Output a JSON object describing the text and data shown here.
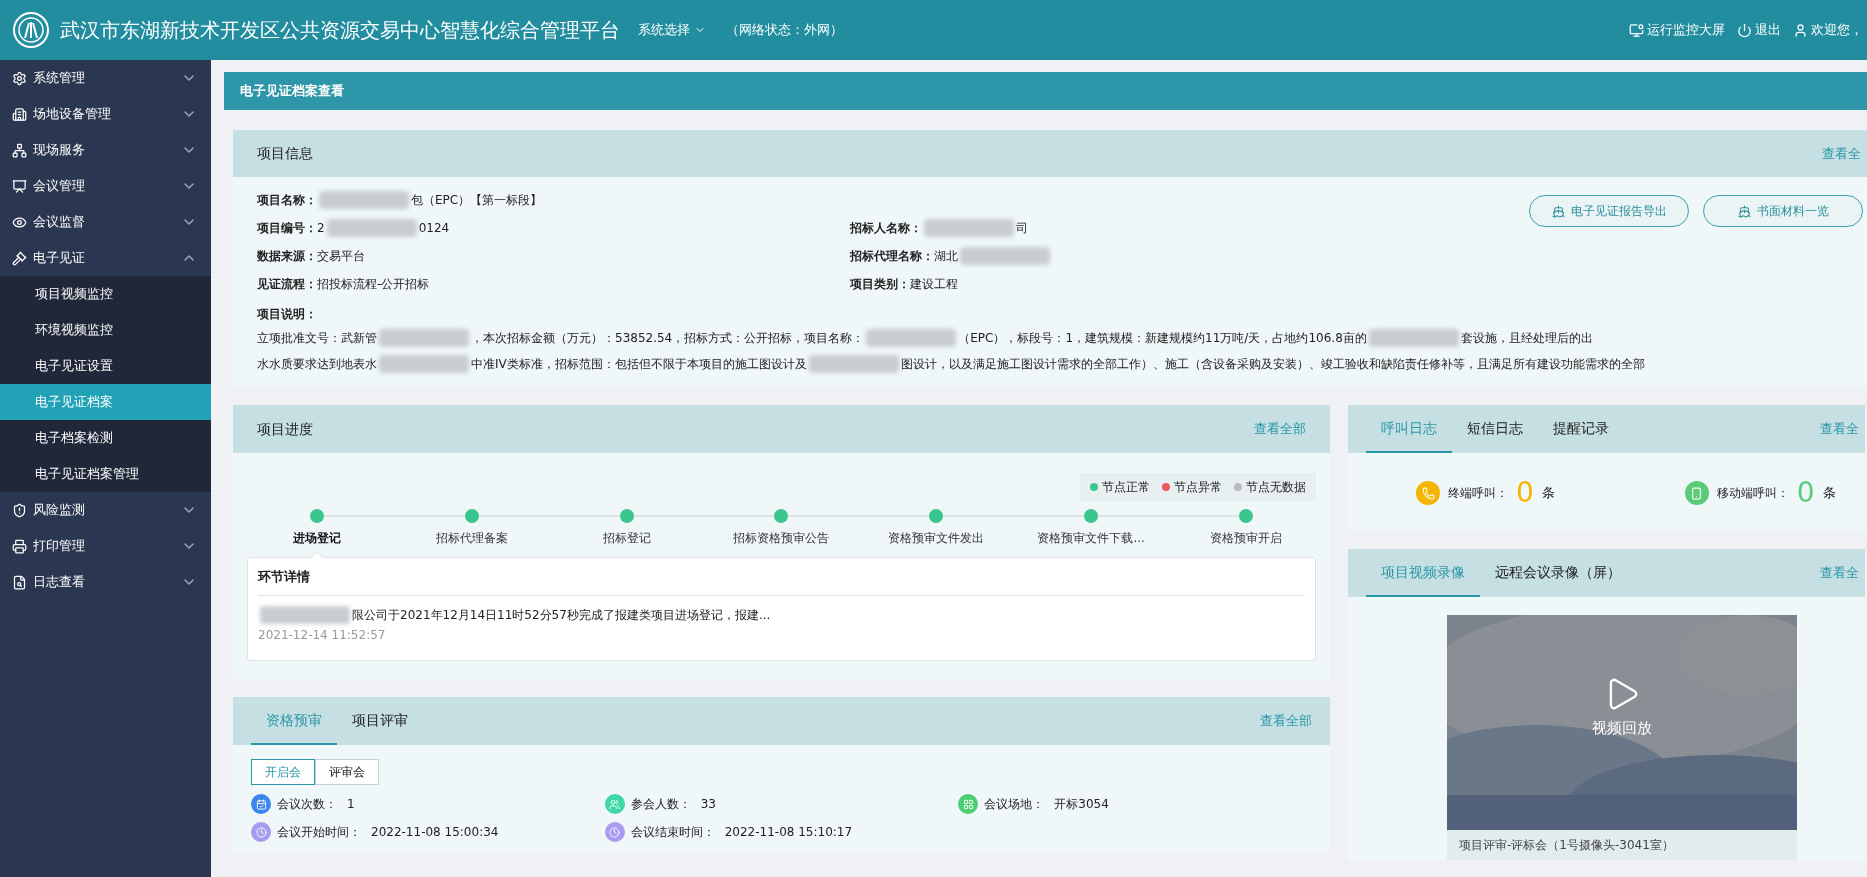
{
  "header": {
    "title": "武汉市东湖新技术开发区公共资源交易中心智慧化综合管理平台",
    "system_select": "系统选择",
    "network": "（网络状态：外网）",
    "actions": [
      {
        "kind": "monitor",
        "label": "运行监控大屏"
      },
      {
        "kind": "power",
        "label": "退出"
      },
      {
        "kind": "user",
        "label": "欢迎您，"
      }
    ]
  },
  "sidebar": {
    "items": [
      {
        "kind": "gear",
        "label": "系统管理",
        "expanded": false
      },
      {
        "kind": "equipment",
        "label": "场地设备管理",
        "expanded": false
      },
      {
        "kind": "service",
        "label": "现场服务",
        "expanded": false
      },
      {
        "kind": "meeting",
        "label": "会议管理",
        "expanded": false
      },
      {
        "kind": "supervise",
        "label": "会议监督",
        "expanded": false
      },
      {
        "kind": "evidence",
        "label": "电子见证",
        "expanded": true,
        "children": [
          {
            "label": "项目视频监控",
            "selected": false
          },
          {
            "label": "环境视频监控",
            "selected": false
          },
          {
            "label": "电子见证设置",
            "selected": false
          },
          {
            "label": "电子见证档案",
            "selected": true
          },
          {
            "label": "电子档案检测",
            "selected": false
          },
          {
            "label": "电子见证档案管理",
            "selected": false
          }
        ]
      },
      {
        "kind": "risk",
        "label": "风险监测",
        "expanded": false
      },
      {
        "kind": "print",
        "label": "打印管理",
        "expanded": false
      },
      {
        "kind": "log",
        "label": "日志查看",
        "expanded": false
      }
    ]
  },
  "breadcrumb": "电子见证档案查看",
  "project_info": {
    "title": "项目信息",
    "view_all": "查看全",
    "left_fields": [
      {
        "label": "项目名称：",
        "parts": [
          {
            "kind": "redacted"
          },
          {
            "kind": "text",
            "text": "包（EPC）【第一标段】"
          }
        ]
      },
      {
        "label": "项目编号：",
        "parts": [
          {
            "kind": "text",
            "text": "2"
          },
          {
            "kind": "redacted"
          },
          {
            "kind": "text",
            "text": "0124"
          }
        ]
      },
      {
        "label": "数据来源：",
        "parts": [
          {
            "kind": "text",
            "text": "交易平台"
          }
        ]
      },
      {
        "label": "见证流程：",
        "parts": [
          {
            "kind": "text",
            "text": "招投标流程-公开招标"
          }
        ]
      }
    ],
    "right_fields": [
      {
        "label": "招标人名称：",
        "parts": [
          {
            "kind": "redacted"
          },
          {
            "kind": "text",
            "text": "司"
          }
        ]
      },
      {
        "label": "招标代理名称：",
        "parts": [
          {
            "kind": "text",
            "text": "湖北"
          },
          {
            "kind": "redacted"
          }
        ]
      },
      {
        "label": "项目类别：",
        "parts": [
          {
            "kind": "text",
            "text": "建设工程"
          }
        ]
      }
    ],
    "buttons": [
      "电子见证报告导出",
      "书面材料一览"
    ],
    "description_label": "项目说明：",
    "description_lines": [
      [
        {
          "kind": "text",
          "text": "立项批准文号：武新管"
        },
        {
          "kind": "redacted"
        },
        {
          "kind": "text",
          "text": "，本次招标金额（万元）：53852.54，招标方式：公开招标，项目名称："
        },
        {
          "kind": "redacted"
        },
        {
          "kind": "text",
          "text": "（EPC），标段号：1，建筑规模：新建规模约11万吨/天，占地约106.8亩的"
        },
        {
          "kind": "redacted"
        },
        {
          "kind": "text",
          "text": "套设施，且经处理后的出"
        }
      ],
      [
        {
          "kind": "text",
          "text": "水水质要求达到地表水"
        },
        {
          "kind": "redacted"
        },
        {
          "kind": "text",
          "text": "中准IV类标准，招标范围：包括但不限于本项目的施工图设计及"
        },
        {
          "kind": "redacted"
        },
        {
          "kind": "text",
          "text": "图设计，以及满足施工图设计需求的全部工作）、施工（含设备采购及安装）、竣工验收和缺陷责任修补等，且满足所有建设功能需求的全部"
        }
      ]
    ]
  },
  "progress": {
    "title": "项目进度",
    "view_all": "查看全部",
    "legend": [
      {
        "label": "节点正常",
        "color": "#3cc68f"
      },
      {
        "label": "节点异常",
        "color": "#ee5a5a"
      },
      {
        "label": "节点无数据",
        "color": "#bbbbbb"
      }
    ],
    "steps": [
      {
        "label": "进场登记",
        "color": "#3cc68f",
        "selected": true
      },
      {
        "label": "招标代理备案",
        "color": "#3cc68f",
        "selected": false
      },
      {
        "label": "招标登记",
        "color": "#3cc68f",
        "selected": false
      },
      {
        "label": "招标资格预审公告",
        "color": "#3cc68f",
        "selected": false
      },
      {
        "label": "资格预审文件发出",
        "color": "#3cc68f",
        "selected": false
      },
      {
        "label": "资格预审文件下载...",
        "color": "#3cc68f",
        "selected": false
      },
      {
        "label": "资格预审开启",
        "color": "#3cc68f",
        "selected": false
      }
    ],
    "detail": {
      "title": "环节详情",
      "parts": [
        {
          "kind": "redacted"
        },
        {
          "kind": "text",
          "text": "限公司于2021年12月14日11时52分57秒完成了报建类项目进场登记，报建..."
        }
      ],
      "time": "2021-12-14 11:52:57"
    }
  },
  "qualification": {
    "tabs": [
      {
        "label": "资格预审",
        "selected": true
      },
      {
        "label": "项目评审",
        "selected": false
      }
    ],
    "view_all": "查看全部",
    "subtabs": [
      {
        "label": "开启会",
        "selected": true
      },
      {
        "label": "评审会",
        "selected": false
      }
    ],
    "stats": [
      {
        "kind": "count",
        "label": "会议次数：",
        "value": "1",
        "color": "#3a86ee"
      },
      {
        "kind": "people",
        "label": "参会人数：",
        "value": "33",
        "color": "#3fd7a5"
      },
      {
        "kind": "venue",
        "label": "会议场地：",
        "value": "开标3054",
        "color": "#4ccd6f"
      },
      {
        "kind": "clock",
        "label": "会议开始时间：",
        "value": "2022-11-08 15:00:34",
        "color": "#a79bf2"
      },
      {
        "kind": "clock",
        "label": "会议结束时间：",
        "value": "2022-11-08 15:10:17",
        "color": "#a79bf2"
      }
    ]
  },
  "call_log": {
    "tabs": [
      {
        "label": "呼叫日志",
        "selected": true
      },
      {
        "label": "短信日志",
        "selected": false
      },
      {
        "label": "提醒记录",
        "selected": false
      }
    ],
    "view_all": "查看全",
    "stats": [
      {
        "kind": "phone",
        "label": "终端呼叫：",
        "value": "0",
        "unit": "条",
        "color": "#f5b400"
      },
      {
        "kind": "mobile",
        "label": "移动端呼叫：",
        "value": "0",
        "unit": "条",
        "color": "#5acb7b"
      }
    ]
  },
  "video": {
    "tabs": [
      {
        "label": "项目视频录像",
        "selected": true
      },
      {
        "label": "远程会议录像（屏）",
        "selected": false
      }
    ],
    "view_all": "查看全",
    "play_label": "视频回放",
    "caption": "项目评审-评标会（1号摄像头-3041室）"
  }
}
